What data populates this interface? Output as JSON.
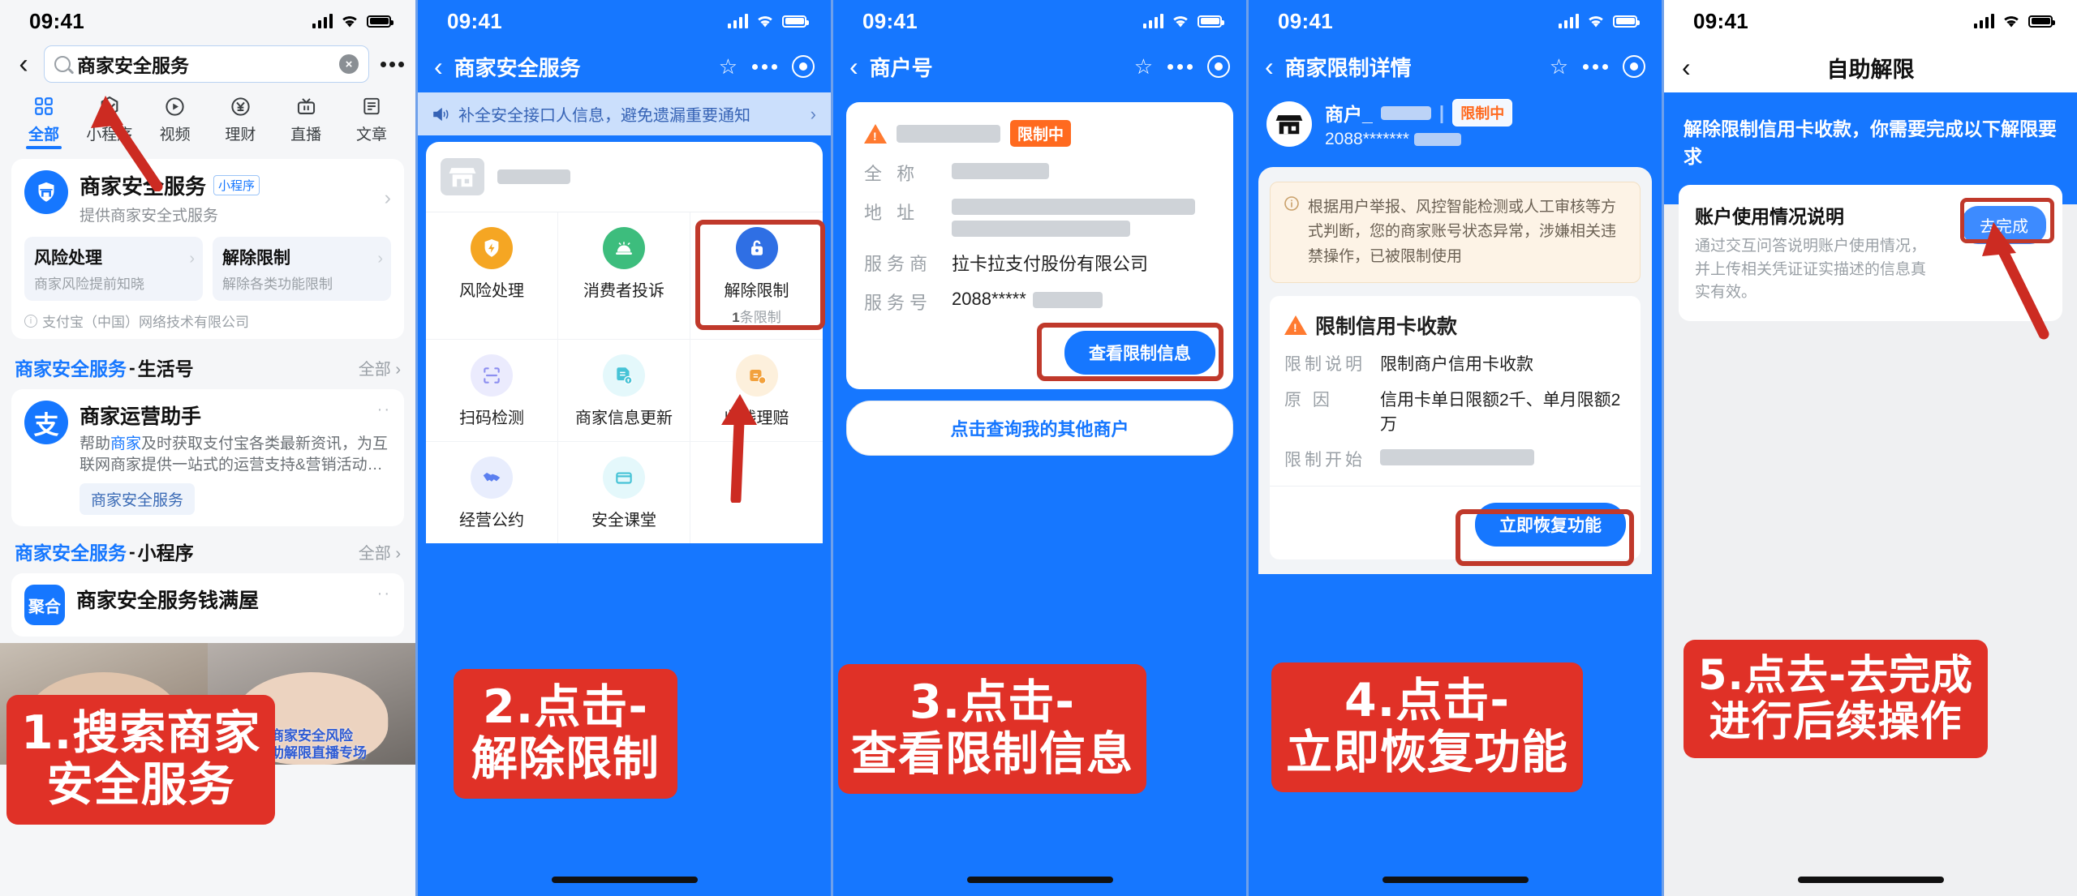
{
  "statusbar": {
    "time": "09:41"
  },
  "panel1": {
    "search": {
      "value": "商家安全服务",
      "icon": "search-icon",
      "clear": "×",
      "more": "more-dots-icon"
    },
    "tabs": [
      {
        "label": "全部",
        "icon": "grid-icon",
        "active": true
      },
      {
        "label": "小程序",
        "icon": "mini-program-icon",
        "active": false
      },
      {
        "label": "视频",
        "icon": "video-play-icon",
        "active": false
      },
      {
        "label": "理财",
        "icon": "yuan-icon",
        "active": false
      },
      {
        "label": "直播",
        "icon": "live-tv-icon",
        "active": false
      },
      {
        "label": "文章",
        "icon": "article-icon",
        "active": false
      }
    ],
    "app": {
      "name": "商家安全服务",
      "badge": "小程序",
      "desc": "提供商家安全式服务",
      "sub": [
        {
          "title": "风险处理",
          "desc": "商家风险提前知晓"
        },
        {
          "title": "解除限制",
          "desc": "解除各类功能限制"
        }
      ],
      "legal": "支付宝（中国）网络技术有限公司"
    },
    "sections": [
      {
        "blue": "商家安全服务",
        "dash": "-",
        "dark": "生活号",
        "all": "全部"
      },
      {
        "blue": "商家安全服务",
        "dash": "-",
        "dark": "小程序",
        "all": "全部"
      }
    ],
    "life": {
      "name": "商家运营助手",
      "desc_a": "帮助",
      "desc_hi": "商家",
      "desc_b": "及时获取支付宝各类最新资讯，为互联网商家提供一站式的运营支持&营销活动…",
      "chip": "商家安全服务",
      "more": "··"
    },
    "mini": {
      "name": "商家安全服务钱满屋",
      "logo": "聚合",
      "more": "··"
    },
    "videos": [
      {
        "caption": ""
      },
      {
        "caption": "商家安全风险\n自助解限直播专场"
      }
    ],
    "caption": {
      "line1": "1.搜索商家",
      "line2": "安全服务"
    }
  },
  "panel2": {
    "nav": {
      "back": "‹",
      "title": "商家安全服务",
      "star": "☆",
      "more": "more-dots-icon",
      "target": "target-icon"
    },
    "notice": {
      "text": "补全安全接口人信息，避免遗漏重要通知",
      "arrow": "›"
    },
    "grid": [
      {
        "label": "风险处理",
        "sub": "",
        "icon": "shield-lightning-icon",
        "color": "#f5a623"
      },
      {
        "label": "消费者投诉",
        "sub": "",
        "icon": "alarm-bell-icon",
        "color": "#3dbd7d"
      },
      {
        "label": "解除限制",
        "sub_num": "1",
        "sub_rest": "条限制",
        "icon": "unlock-icon",
        "color": "#2f6fe4",
        "highlight": true
      },
      {
        "label": "扫码检测",
        "sub": "",
        "icon": "scan-code-icon",
        "color": "#8d8ff0"
      },
      {
        "label": "商家信息更新",
        "sub": "",
        "icon": "document-update-icon",
        "color": "#46c3d6"
      },
      {
        "label": "收钱理赔",
        "sub": "",
        "icon": "money-claim-icon",
        "color": "#f2a13c"
      },
      {
        "label": "经营公约",
        "sub": "",
        "icon": "handshake-icon",
        "color": "#5b7ff0"
      },
      {
        "label": "安全课堂",
        "sub": "",
        "icon": "book-icon",
        "color": "#46c3d6"
      }
    ],
    "caption": {
      "line1": "2.点击-",
      "line2": "解除限制"
    }
  },
  "panel3": {
    "nav": {
      "back": "‹",
      "title": "商户号",
      "star": "☆",
      "more": "more-dots-icon",
      "target": "target-icon"
    },
    "status_chip": "限制中",
    "fields": [
      {
        "label": "全 称",
        "value": ""
      },
      {
        "label": "地 址",
        "value": ""
      },
      {
        "label": "服务商",
        "value": "拉卡拉支付股份有限公司"
      },
      {
        "label": "服务号",
        "value": "2088*****"
      }
    ],
    "primary_button": "查看限制信息",
    "ghost_button": "点击查询我的其他商户",
    "caption": {
      "line1": "3.点击-",
      "line2": "查看限制信息"
    }
  },
  "panel4": {
    "nav": {
      "back": "‹",
      "title": "商家限制详情",
      "star": "☆",
      "more": "more-dots-icon",
      "target": "target-icon"
    },
    "merchant": {
      "name": "商户_",
      "number": "2088*******",
      "chip": "限制中"
    },
    "info": "根据用户举报、风控智能检测或人工审核等方式判断，您的商家账号状态异常，涉嫌相关违禁操作，已被限制使用",
    "restriction": {
      "title": "限制信用卡收款",
      "rows": [
        {
          "label": "限制说明",
          "value": "限制商户信用卡收款"
        },
        {
          "label": "原 因",
          "value": "信用卡单日限额2千、单月限额2万"
        },
        {
          "label": "限制开始",
          "value": ""
        }
      ],
      "button": "立即恢复功能"
    },
    "caption": {
      "line1": "4.点击-",
      "line2": "立即恢复功能"
    }
  },
  "panel5": {
    "nav": {
      "back": "‹",
      "title": "自助解限"
    },
    "lead": "解除限制信用卡收款，你需要完成以下解限要求",
    "task": {
      "title": "账户使用情况说明",
      "desc": "通过交互问答说明账户使用情况，并上传相关凭证证实描述的信息真实有效。",
      "button": "去完成"
    },
    "caption": {
      "line1": "5.点去-去完成",
      "line2": "进行后续操作"
    }
  },
  "colors": {
    "brand_blue": "#1677ff",
    "caption_red": "#e03127",
    "highlight_red": "#c0392b",
    "warn_orange": "#ff6a1f"
  }
}
